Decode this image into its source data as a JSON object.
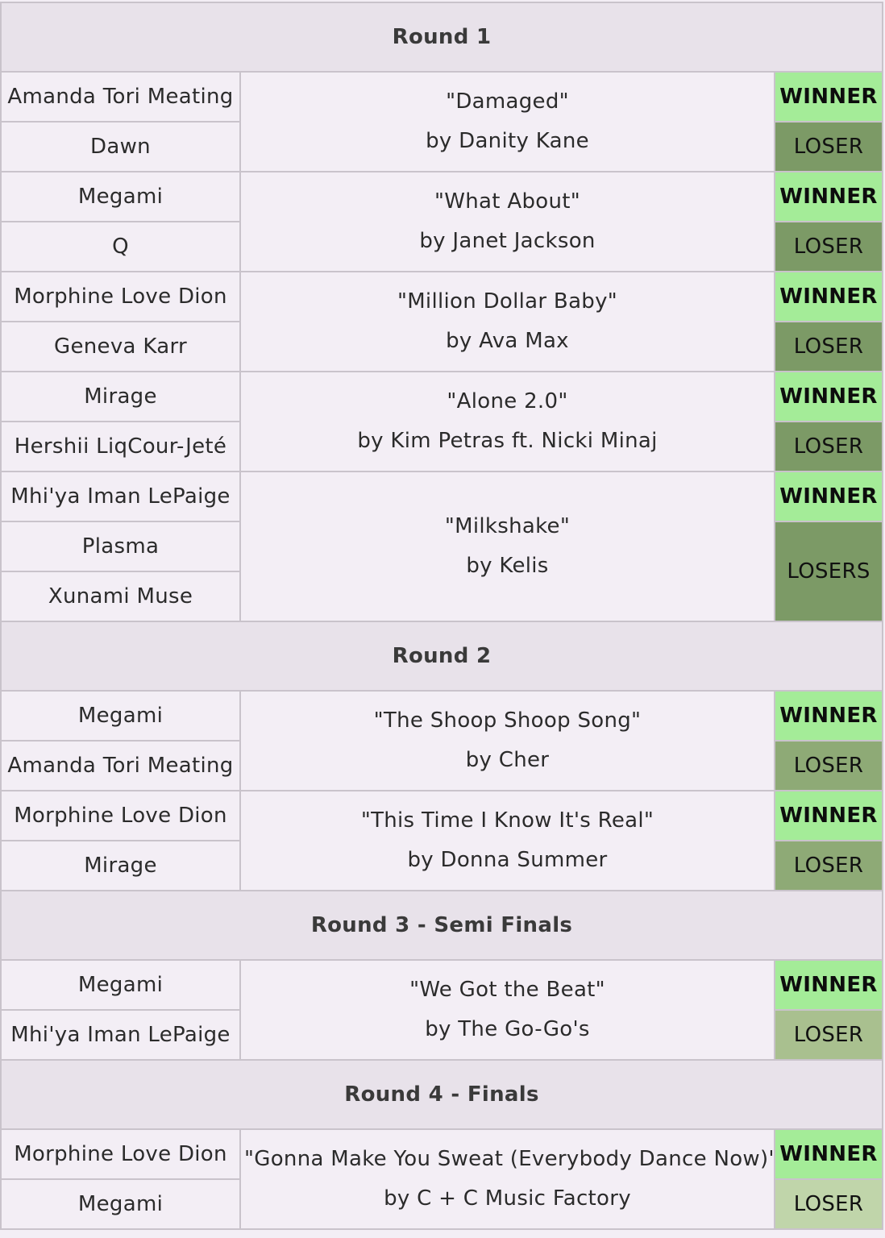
{
  "colors": {
    "winner": "#a4ec98",
    "loser_dark": "#7c9a66",
    "loser_mid": "#8eaa76",
    "loser_light": "#a9c08f",
    "loser_pale": "#c0d5aa",
    "round_header": "#e8e2ea",
    "cell": "#f3eef5"
  },
  "rounds": [
    {
      "title": "Round 1",
      "matches": [
        {
          "contestants": [
            "Amanda Tori Meating",
            "Dawn"
          ],
          "song": "\"Damaged\"",
          "artist": "by Danity Kane",
          "winner_label": "WINNER",
          "loser_label": "LOSER"
        },
        {
          "contestants": [
            "Megami",
            "Q"
          ],
          "song": "\"What About\"",
          "artist": "by Janet Jackson",
          "winner_label": "WINNER",
          "loser_label": "LOSER"
        },
        {
          "contestants": [
            "Morphine Love Dion",
            "Geneva Karr"
          ],
          "song": "\"Million Dollar Baby\"",
          "artist": "by Ava Max",
          "winner_label": "WINNER",
          "loser_label": "LOSER"
        },
        {
          "contestants": [
            "Mirage",
            "Hershii LiqCour-Jeté"
          ],
          "song": "\"Alone 2.0\"",
          "artist": "by Kim Petras ft. Nicki Minaj",
          "winner_label": "WINNER",
          "loser_label": "LOSER"
        },
        {
          "contestants": [
            "Mhi'ya Iman LePaige",
            "Plasma",
            "Xunami Muse"
          ],
          "song": "\"Milkshake\"",
          "artist": "by Kelis",
          "winner_label": "WINNER",
          "loser_label": "LOSERS"
        }
      ]
    },
    {
      "title": "Round 2",
      "matches": [
        {
          "contestants": [
            "Megami",
            "Amanda Tori Meating"
          ],
          "song": "\"The Shoop Shoop Song\"",
          "artist": "by Cher",
          "winner_label": "WINNER",
          "loser_label": "LOSER"
        },
        {
          "contestants": [
            "Morphine Love Dion",
            "Mirage"
          ],
          "song": "\"This Time I Know It's Real\"",
          "artist": "by Donna Summer",
          "winner_label": "WINNER",
          "loser_label": "LOSER"
        }
      ]
    },
    {
      "title": "Round 3 - Semi Finals",
      "matches": [
        {
          "contestants": [
            "Megami",
            "Mhi'ya Iman LePaige"
          ],
          "song": "\"We Got the Beat\"",
          "artist": "by The Go-Go's",
          "winner_label": "WINNER",
          "loser_label": "LOSER"
        }
      ]
    },
    {
      "title": "Round 4 - Finals",
      "matches": [
        {
          "contestants": [
            "Morphine Love Dion",
            "Megami"
          ],
          "song": "\"Gonna Make You Sweat (Everybody Dance Now)\"",
          "artist": "by C + C Music Factory",
          "winner_label": "WINNER",
          "loser_label": "LOSER"
        }
      ]
    }
  ]
}
